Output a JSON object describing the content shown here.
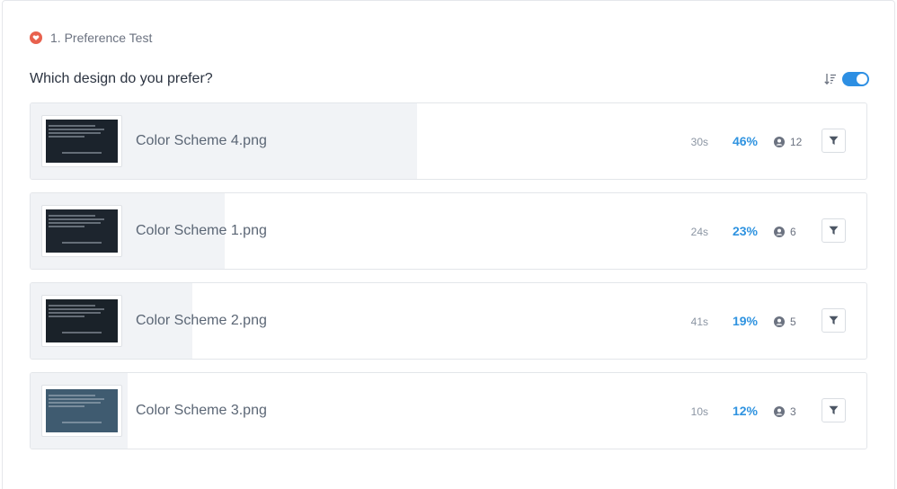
{
  "section": {
    "title": "1. Preference Test",
    "icon": "heart-icon",
    "icon_color": "#e8614e"
  },
  "question": "Which design do you prefer?",
  "controls": {
    "sort_icon": "sort-icon",
    "toggle_on": true,
    "accent": "#2d8fe3"
  },
  "options": [
    {
      "name": "Color Scheme 4.png",
      "time": "30s",
      "percent": "46%",
      "percent_value": 46,
      "users": "12",
      "thumb_color": "#1b232c"
    },
    {
      "name": "Color Scheme 1.png",
      "time": "24s",
      "percent": "23%",
      "percent_value": 23,
      "users": "6",
      "thumb_color": "#1d252e"
    },
    {
      "name": "Color Scheme 2.png",
      "time": "41s",
      "percent": "19%",
      "percent_value": 19,
      "users": "5",
      "thumb_color": "#1a2229"
    },
    {
      "name": "Color Scheme 3.png",
      "time": "10s",
      "percent": "12%",
      "percent_value": 12,
      "users": "3",
      "thumb_color": "#3f5b70"
    }
  ]
}
